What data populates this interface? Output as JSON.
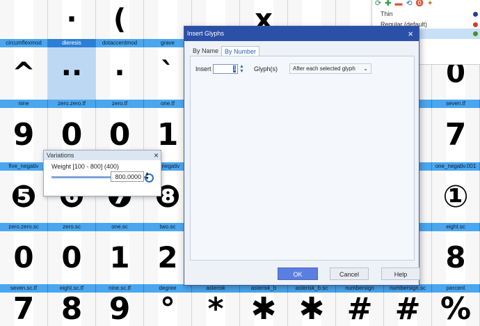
{
  "grid": {
    "rows": [
      {
        "labels": [],
        "cells": [
          {
            "glyph": ""
          },
          {
            "glyph": "·"
          },
          {
            "glyph": "("
          },
          {
            "glyph": ""
          },
          {
            "glyph": ""
          },
          {
            "glyph": "x"
          },
          {
            "glyph": ""
          },
          {
            "glyph": ""
          },
          {
            "glyph": ""
          },
          {
            "glyph": ""
          }
        ]
      },
      {
        "labels": [
          "circumflexmod",
          "dieresis",
          "dotaccentmod",
          "grave",
          "",
          "",
          "",
          "",
          "",
          ""
        ],
        "cells": [
          {
            "glyph": "^"
          },
          {
            "glyph": "··",
            "selected": true
          },
          {
            "glyph": "·"
          },
          {
            "glyph": "`"
          },
          {
            "glyph": ""
          },
          {
            "glyph": ""
          },
          {
            "glyph": ""
          },
          {
            "glyph": ""
          },
          {
            "glyph": ""
          },
          {
            "glyph": "0"
          }
        ]
      },
      {
        "labels": [
          "nine",
          "zero.zero.tf",
          "zero.tf",
          "one.tf",
          "",
          "",
          "",
          "",
          "",
          "seven.tf"
        ],
        "cells": [
          {
            "glyph": "9"
          },
          {
            "glyph": "0"
          },
          {
            "glyph": "0"
          },
          {
            "glyph": "1"
          },
          {
            "glyph": ""
          },
          {
            "glyph": ""
          },
          {
            "glyph": ""
          },
          {
            "glyph": ""
          },
          {
            "glyph": ""
          },
          {
            "glyph": "7"
          }
        ]
      },
      {
        "labels": [
          "five_negativ",
          "",
          "",
          "e_negativ",
          "",
          "",
          "",
          "",
          "01",
          "one_negativ.001"
        ],
        "cells": [
          {
            "glyph": "❺"
          },
          {
            "glyph": "❻"
          },
          {
            "glyph": "❼"
          },
          {
            "glyph": "❽"
          },
          {
            "glyph": ""
          },
          {
            "glyph": ""
          },
          {
            "glyph": ""
          },
          {
            "glyph": ""
          },
          {
            "glyph": ""
          },
          {
            "glyph": "①"
          }
        ]
      },
      {
        "labels": [
          "zero.zero.sc",
          "zero.sc",
          "one.sc",
          "two.sc",
          "",
          "",
          "",
          "",
          "",
          "eight.sc"
        ],
        "cells": [
          {
            "glyph": "0"
          },
          {
            "glyph": "0"
          },
          {
            "glyph": "1"
          },
          {
            "glyph": "2"
          },
          {
            "glyph": ""
          },
          {
            "glyph": ""
          },
          {
            "glyph": ""
          },
          {
            "glyph": ""
          },
          {
            "glyph": ""
          },
          {
            "glyph": "8"
          }
        ]
      },
      {
        "labels": [
          "seven.sc.tf",
          "eight.sc.tf",
          "nine.sc.tf",
          "degree",
          "asterisk",
          "asterisk_b",
          "asterisk_b.sc",
          "numbersign",
          "numbersign.sc",
          "percent"
        ],
        "cells": [
          {
            "glyph": "7"
          },
          {
            "glyph": "8"
          },
          {
            "glyph": "9"
          },
          {
            "glyph": "°"
          },
          {
            "glyph": "*"
          },
          {
            "glyph": "✱"
          },
          {
            "glyph": "✱"
          },
          {
            "glyph": "#"
          },
          {
            "glyph": "#"
          },
          {
            "glyph": "%"
          }
        ]
      }
    ]
  },
  "layers": {
    "items": [
      {
        "label": "Thin",
        "color": "#2b3f8f"
      },
      {
        "label": "Regular (default)",
        "color": "#d43a2a"
      },
      {
        "label": "",
        "color": "#4a8f2a",
        "active": true
      }
    ],
    "tool_icons": [
      "refresh-icon",
      "add-layer-icon",
      "remove-layer-icon",
      "sync-icon",
      "warning-icon",
      "magic-wand-icon"
    ]
  },
  "variations": {
    "title": "Variations",
    "axis_label": "Weight [100 - 800] (400)",
    "value": "800.0000",
    "slider_fraction": 1.0
  },
  "dialog": {
    "title": "Insert Glyphs",
    "tabs": [
      {
        "label": "By Name"
      },
      {
        "label": "By Number",
        "active": true
      }
    ],
    "insert_label": "Insert",
    "count": "1",
    "glyphs_label": "Glyph(s)",
    "position_option": "After each selected glyph",
    "ok_label": "OK",
    "cancel_label": "Cancel",
    "help_label": "Help"
  },
  "colors": {
    "label_bar": "#4aa6ee",
    "dialog_title": "#2b50a8",
    "ok_button": "#5b7fe0",
    "selection": "#bcd8f2"
  }
}
